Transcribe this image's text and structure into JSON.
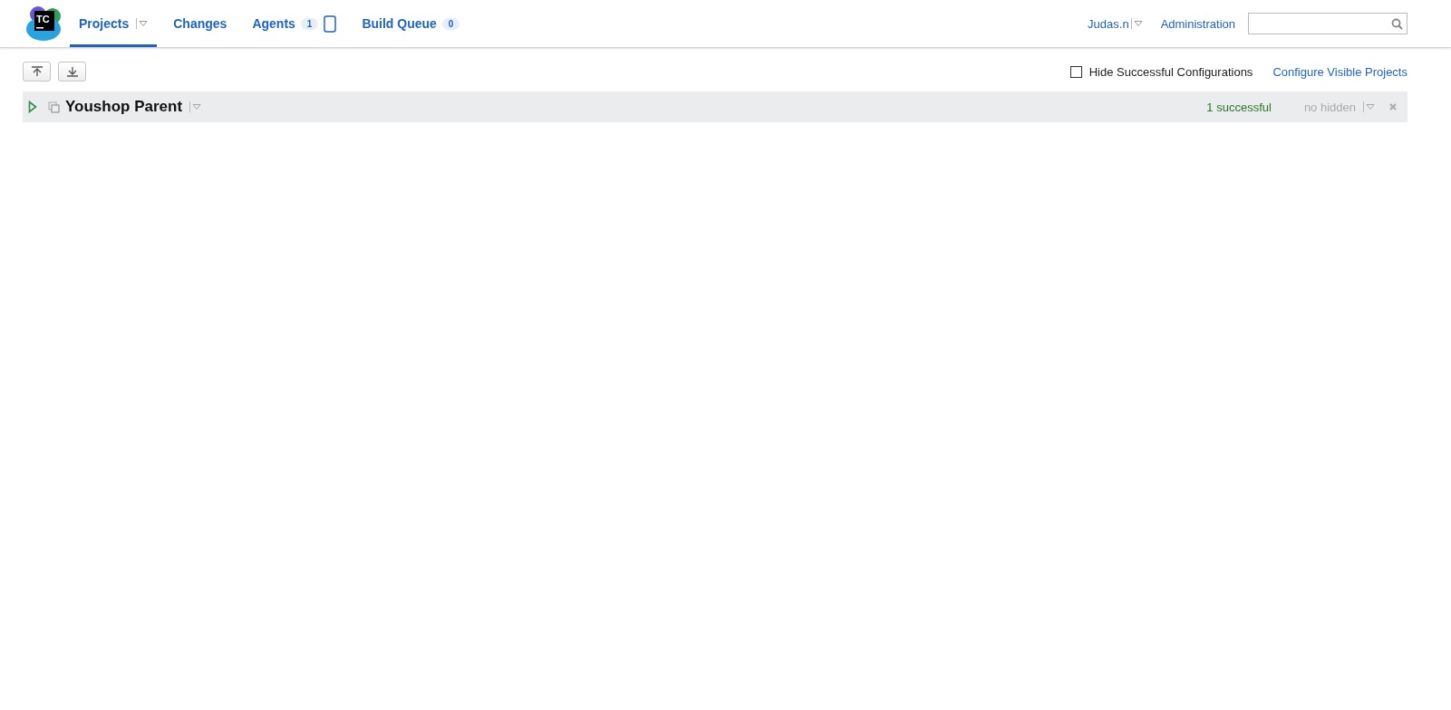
{
  "nav": {
    "logo_text": "TC",
    "tabs": [
      {
        "label": "Projects",
        "selected": true,
        "kind": "dropdown"
      },
      {
        "label": "Changes",
        "selected": false,
        "kind": "plain"
      },
      {
        "label": "Agents",
        "selected": false,
        "kind": "device",
        "count": "1"
      },
      {
        "label": "Build Queue",
        "selected": false,
        "kind": "plain",
        "count": "0"
      }
    ],
    "user": "Judas.n",
    "admin": "Administration"
  },
  "toolbar": {
    "hide_successful": {
      "label": "Hide Successful Configurations",
      "checked": false
    },
    "configure_link": "Configure Visible Projects"
  },
  "projects": [
    {
      "name": "Youshop Parent",
      "expanded": false,
      "status": "1 successful",
      "hidden": "no hidden"
    }
  ]
}
